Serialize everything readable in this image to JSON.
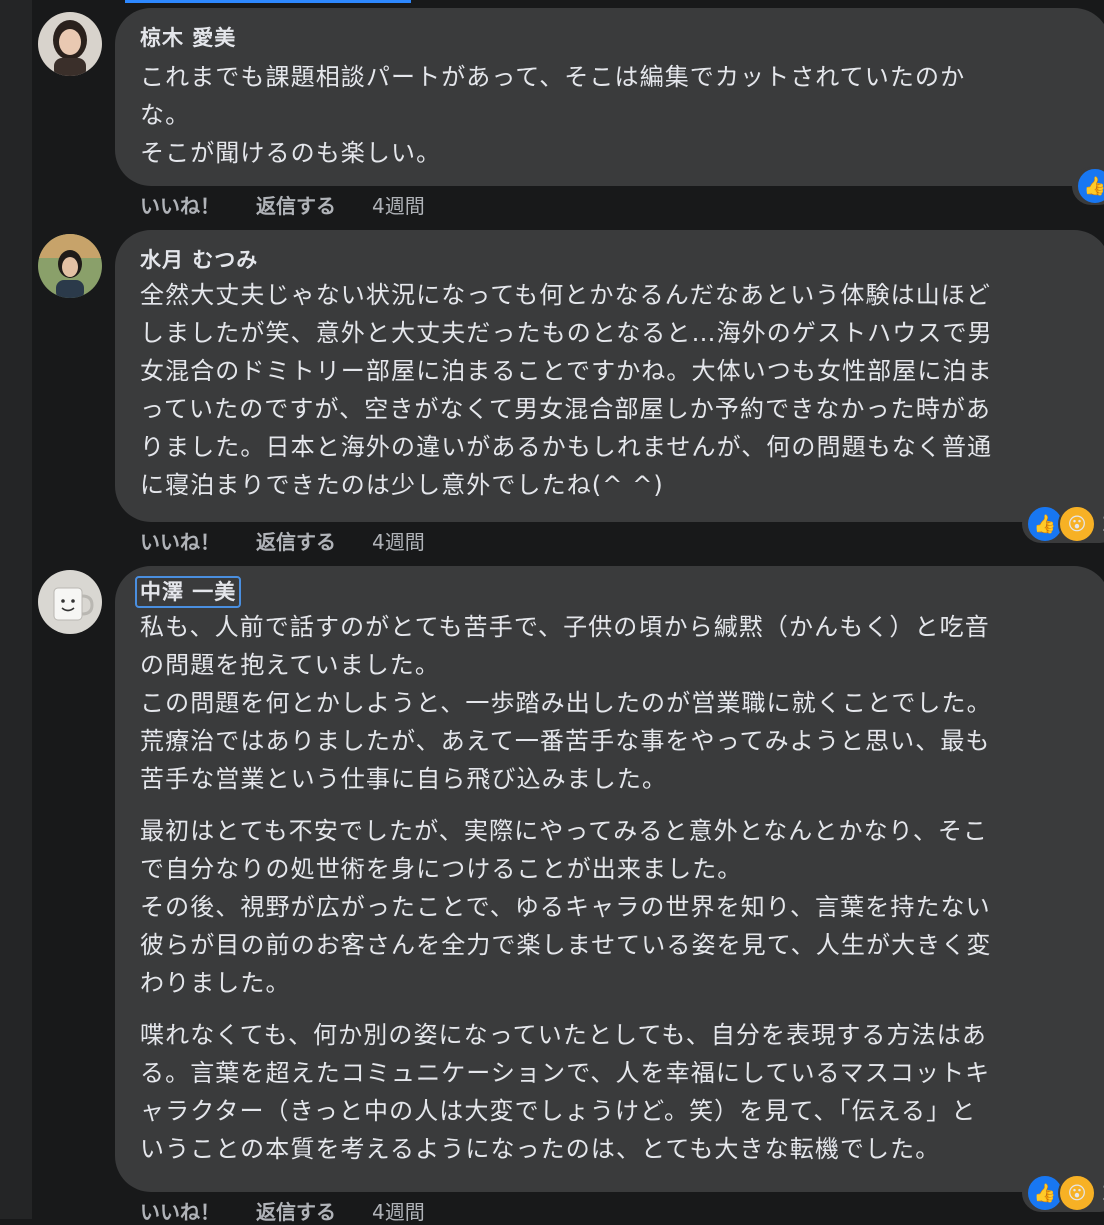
{
  "comments": [
    {
      "author": "椋木 愛美",
      "lines": [
        "これまでも課題相談パートがあって、そこは編集でカットされていたのか",
        "な。",
        "そこが聞けるのも楽しい。"
      ],
      "like_label": "いいね！",
      "reply_label": "返信する",
      "time": "4週間"
    },
    {
      "author": "水月 むつみ",
      "lines": [
        "全然大丈夫じゃない状況になっても何とかなるんだなあという体験は山ほど",
        "しましたが笑、意外と大丈夫だったものとなると…海外のゲストハウスで男",
        "女混合のドミトリー部屋に泊まることですかね。大体いつも女性部屋に泊ま",
        "っていたのですが、空きがなくて男女混合部屋しか予約できなかった時があ",
        "りました。日本と海外の違いがあるかもしれませんが、何の問題もなく普通",
        "に寝泊まりできたのは少し意外でしたね(^ ^)"
      ],
      "like_label": "いいね！",
      "reply_label": "返信する",
      "time": "4週間",
      "reaction_count": "2"
    },
    {
      "author": "中澤 一美",
      "para1": [
        "私も、人前で話すのがとても苦手で、子供の頃から緘黙（かんもく）と吃音",
        "の問題を抱えていました。",
        "この問題を何とかしようと、一歩踏み出したのが営業職に就くことでした。",
        "荒療治ではありましたが、あえて一番苦手な事をやってみようと思い、最も",
        "苦手な営業という仕事に自ら飛び込みました。"
      ],
      "para2": [
        "最初はとても不安でしたが、実際にやってみると意外となんとかなり、そこ",
        "で自分なりの処世術を身につけることが出来ました。",
        "その後、視野が広がったことで、ゆるキャラの世界を知り、言葉を持たない",
        "彼らが目の前のお客さんを全力で楽しませている姿を見て、人生が大きく変",
        "わりました。"
      ],
      "para3": [
        "喋れなくても、何か別の姿になっていたとしても、自分を表現する方法はあ",
        "る。言葉を超えたコミュニケーションで、人を幸福にしているマスコットキ",
        "ャラクター（きっと中の人は大変でしょうけど。笑）を見て、「伝える」と",
        "いうことの本質を考えるようになったのは、とても大きな転機でした。"
      ],
      "like_label": "いいね！",
      "reply_label": "返信する",
      "time": "4週間",
      "reaction_count": "2"
    }
  ],
  "icons": {
    "like": "thumbs-up-icon",
    "wow": "wow-face-icon"
  },
  "colors": {
    "background": "#18191a",
    "bubble": "#3a3b3c",
    "accent": "#2d88ff",
    "like": "#1877f2",
    "wow": "#f7b125"
  }
}
